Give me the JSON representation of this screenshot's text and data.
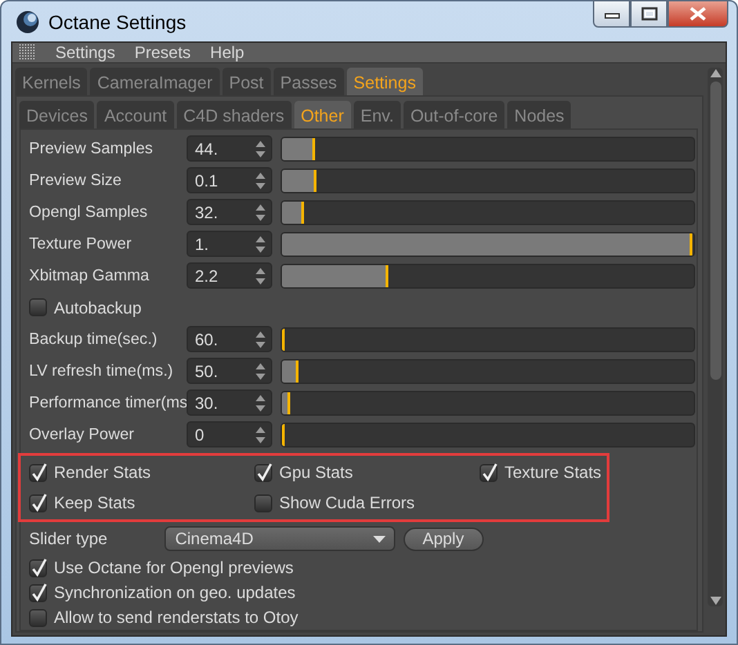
{
  "window": {
    "title": "Octane Settings"
  },
  "menu": [
    "Settings",
    "Presets",
    "Help"
  ],
  "tabs": [
    {
      "label": "Kernels",
      "selected": false
    },
    {
      "label": "CameraImager",
      "selected": false
    },
    {
      "label": "Post",
      "selected": false
    },
    {
      "label": "Passes",
      "selected": false
    },
    {
      "label": "Settings",
      "selected": true
    }
  ],
  "subtabs": [
    {
      "label": "Devices",
      "selected": false
    },
    {
      "label": "Account",
      "selected": false
    },
    {
      "label": "C4D shaders",
      "selected": false
    },
    {
      "label": "Other",
      "selected": true
    },
    {
      "label": "Env.",
      "selected": false
    },
    {
      "label": "Out-of-core",
      "selected": false
    },
    {
      "label": "Nodes",
      "selected": false
    }
  ],
  "params": [
    {
      "kind": "slider",
      "label": "Preview Samples",
      "value": "44.",
      "level": 0.08
    },
    {
      "kind": "slider",
      "label": "Preview Size",
      "value": "0.1",
      "level": 0.085
    },
    {
      "kind": "slider",
      "label": "Opengl Samples",
      "value": "32.",
      "level": 0.055
    },
    {
      "kind": "slider",
      "label": "Texture Power",
      "value": "1.",
      "level": 0.995
    },
    {
      "kind": "slider",
      "label": "Xbitmap Gamma",
      "value": "2.2",
      "level": 0.26
    },
    {
      "kind": "checkbox",
      "label": "Autobackup",
      "checked": false
    },
    {
      "kind": "slider",
      "label": "Backup time(sec.)",
      "value": "60.",
      "level": 0.0
    },
    {
      "kind": "slider",
      "label": "LV refresh time(ms.)",
      "value": "50.",
      "level": 0.04
    },
    {
      "kind": "slider",
      "label": "Performance timer(ms",
      "value": "30.",
      "level": 0.02
    },
    {
      "kind": "slider",
      "label": "Overlay Power",
      "value": "0",
      "level": 0.0
    }
  ],
  "stats": [
    {
      "label": "Render Stats",
      "checked": true
    },
    {
      "label": "Gpu Stats",
      "checked": true
    },
    {
      "label": "Texture Stats",
      "checked": true
    },
    {
      "label": "Keep Stats",
      "checked": true
    },
    {
      "label": "Show Cuda Errors",
      "checked": false
    }
  ],
  "slider_type": {
    "label": "Slider type",
    "value": "Cinema4D",
    "button": "Apply"
  },
  "options": [
    {
      "label": "Use Octane for Opengl previews",
      "checked": true
    },
    {
      "label": "Synchronization on geo. updates",
      "checked": true
    },
    {
      "label": "Allow to send renderstats to Otoy",
      "checked": false
    }
  ]
}
